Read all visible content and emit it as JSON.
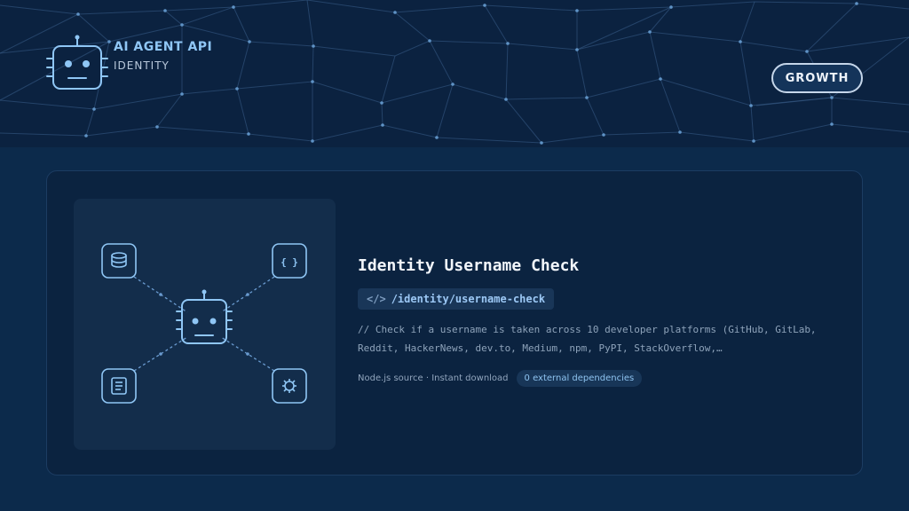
{
  "brand": {
    "title": "AI AGENT API",
    "subtitle": "IDENTITY",
    "logo_icon": "robot-icon"
  },
  "category_badge": "GROWTH",
  "card": {
    "title": "Identity Username Check",
    "endpoint_icon": "</>",
    "endpoint": "/identity/username-check",
    "description_lines": [
      "// Check if a username is taken across 10 developer platforms (GitHub, GitLab,",
      "Reddit, HackerNews, dev.to, Medium, npm, PyPI, StackOverflow,…"
    ],
    "meta_text": "Node.js source · Instant download",
    "deps_badge": "0 external dependencies",
    "illustration_icons": [
      "database-icon",
      "code-braces-icon",
      "document-icon",
      "network-hub-icon",
      "robot-icon"
    ]
  },
  "colors": {
    "page_bg": "#0c2a4b",
    "header_bg": "#0b2240",
    "card_bg": "#0b2340",
    "accent": "#8fc6f5"
  }
}
